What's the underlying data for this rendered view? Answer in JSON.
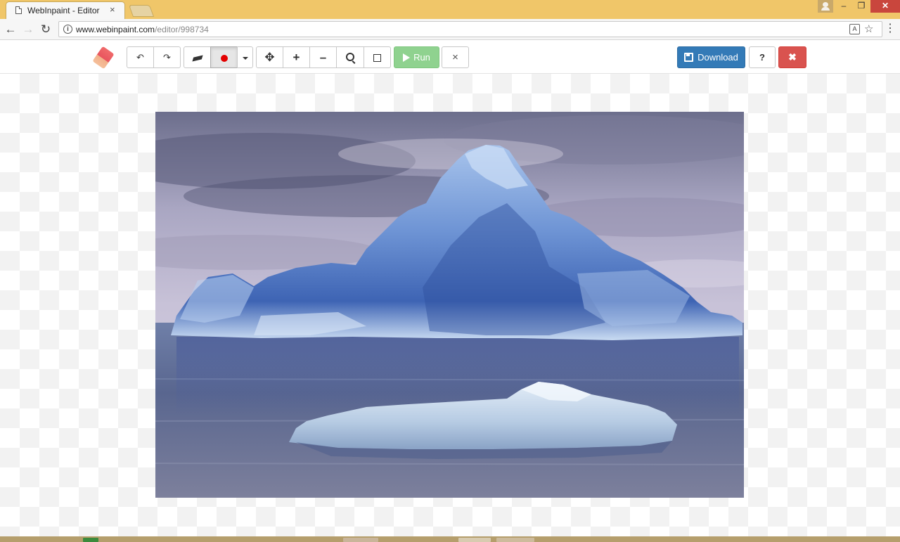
{
  "browser": {
    "tab_title": "WebInpaint - Editor",
    "tab_close": "×",
    "url_host": "www.webinpaint.com",
    "url_path": "/editor/998734",
    "window_controls": [
      "user-icon",
      "minimize",
      "restore",
      "close"
    ]
  },
  "toolbar": {
    "logo": "eraser-logo-icon",
    "buttons": [
      {
        "name": "undo",
        "icon": "undo-icon"
      },
      {
        "name": "redo",
        "icon": "redo-icon"
      },
      {
        "name": "eraser",
        "icon": "eraser-icon"
      },
      {
        "name": "brush-color",
        "icon": "red-dot-icon",
        "color": "#e30000",
        "active": true
      },
      {
        "name": "brush-size-dropdown",
        "icon": "caret-down-icon"
      },
      {
        "name": "move",
        "icon": "move-arrows-icon"
      },
      {
        "name": "zoom-in",
        "icon": "plus-icon"
      },
      {
        "name": "zoom-out",
        "icon": "minus-icon"
      },
      {
        "name": "zoom-fit",
        "icon": "search-icon"
      },
      {
        "name": "frame",
        "icon": "square-icon"
      },
      {
        "name": "cancel",
        "icon": "times-icon"
      },
      {
        "name": "help",
        "icon": "question-icon"
      },
      {
        "name": "close",
        "icon": "close-icon"
      }
    ],
    "run_label": "Run",
    "download_label": "Download",
    "help_label": "?",
    "colors": {
      "run": "#8fd28f",
      "download": "#337ab7",
      "close": "#d9534f",
      "titlebar": "#f0c669"
    }
  },
  "canvas": {
    "image_subject": "iceberg on water under cloudy sky",
    "background": "transparency-checkerboard"
  }
}
